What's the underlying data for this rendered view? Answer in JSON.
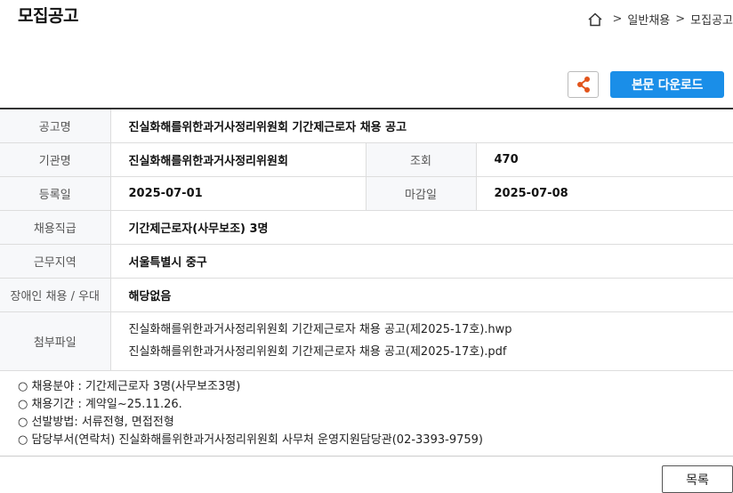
{
  "page_title": "모집공고",
  "breadcrumb": {
    "items": [
      "일반채용",
      "모집공고"
    ],
    "separator": ">"
  },
  "toolbar": {
    "share_icon": "share-icon",
    "download_label": "본문 다운로드",
    "download_color": "#1a8ee8"
  },
  "info": {
    "labels": {
      "title": "공고명",
      "agency": "기관명",
      "views": "조회",
      "registered": "등록일",
      "deadline": "마감일",
      "position": "채용직급",
      "location": "근무지역",
      "disability": "장애인 채용 / 우대",
      "attachments": "첨부파일"
    },
    "values": {
      "title": "진실화해를위한과거사정리위원회 기간제근로자 채용 공고",
      "agency": "진실화해를위한과거사정리위원회",
      "views": "470",
      "registered": "2025-07-01",
      "deadline": "2025-07-08",
      "position": "기간제근로자(사무보조) 3명",
      "location": "서울특별시 중구",
      "disability": "해당없음"
    },
    "attachments": [
      "진실화해를위한과거사정리위원회 기간제근로자 채용 공고(제2025-17호).hwp",
      "진실화해를위한과거사정리위원회 기간제근로자 채용 공고(제2025-17호).pdf"
    ]
  },
  "notes": [
    "○ 채용분야 : 기간제근로자 3명(사무보조3명)",
    "○ 채용기간 : 계약일~25.11.26.",
    "○ 선발방법: 서류전형, 면접전형",
    "○ 담당부서(연락처) 진실화해를위한과거사정리위원회 사무처 운영지원담당관(02-3393-9759)"
  ],
  "footer": {
    "list_label": "목록"
  }
}
